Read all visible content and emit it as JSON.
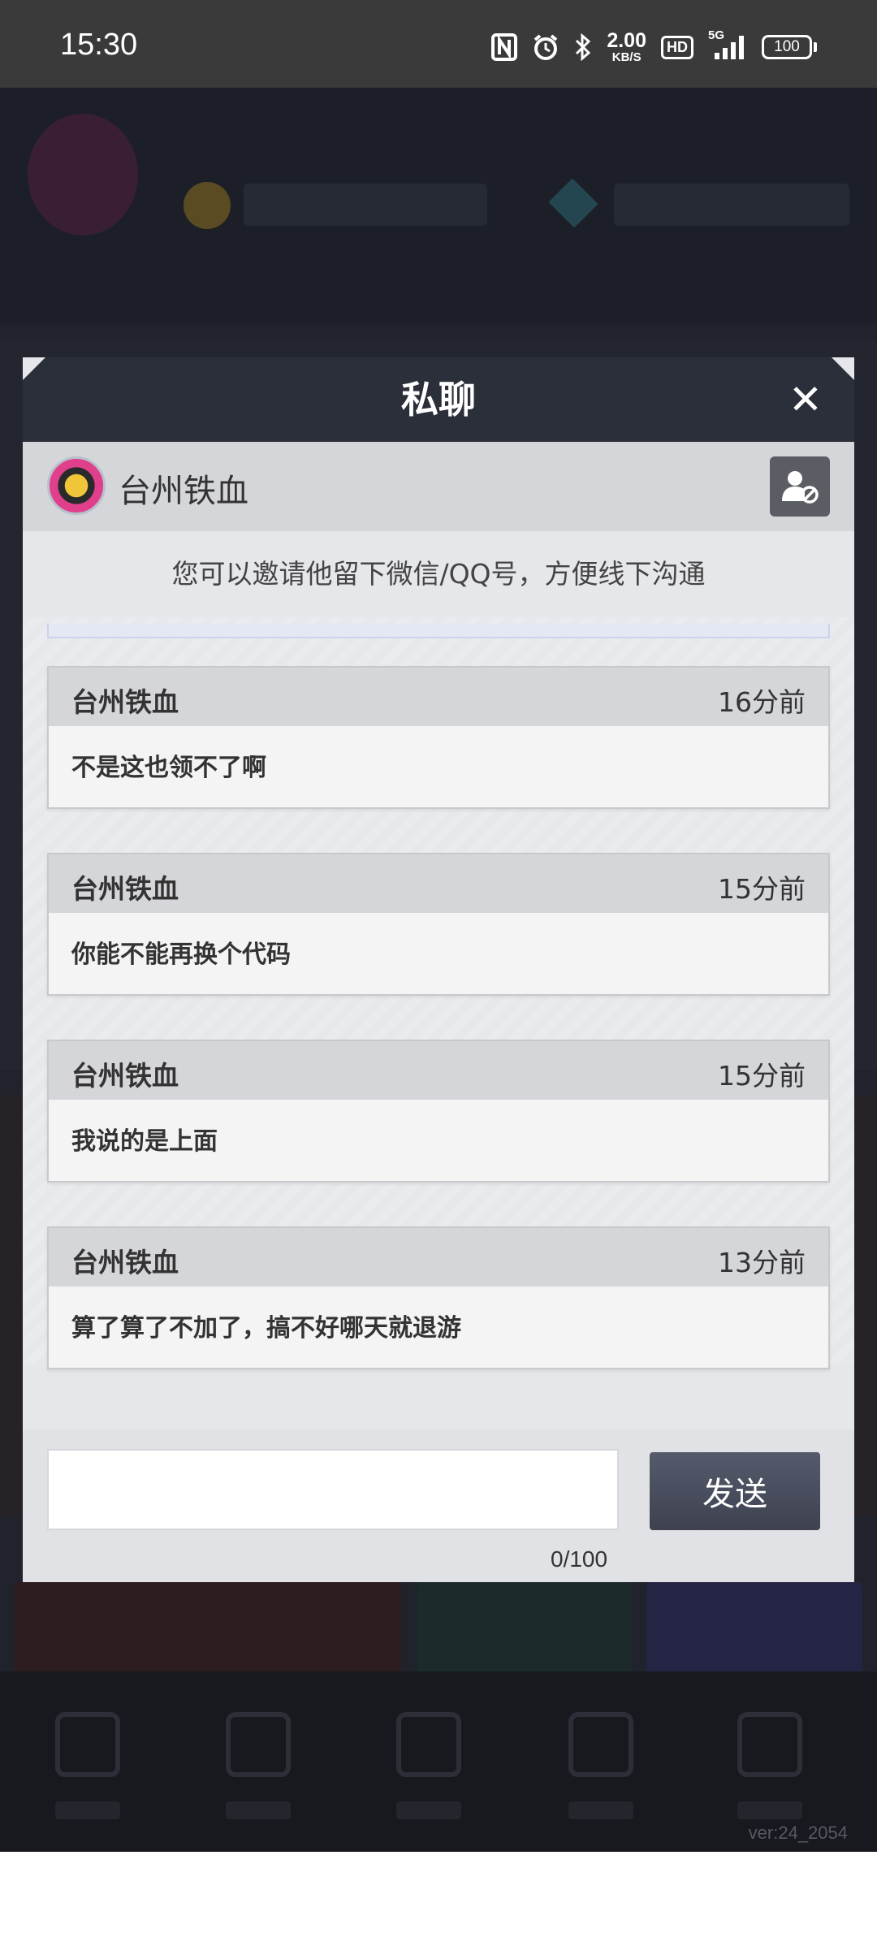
{
  "status_bar": {
    "time": "15:30",
    "net_speed_value": "2.00",
    "net_speed_unit": "KB/S",
    "hd_label": "HD",
    "network_label": "5G",
    "battery_level": "100",
    "icons": [
      "nfc-icon",
      "alarm-icon",
      "bluetooth-icon",
      "hd-icon",
      "signal-icon",
      "battery-icon"
    ]
  },
  "modal": {
    "title": "私聊",
    "close_glyph": "✕",
    "peer": {
      "name": "台州铁血"
    },
    "invite_hint": "您可以邀请他留下微信/QQ号，方便线下沟通",
    "messages": [
      {
        "sender": "台州铁血",
        "time": "16分前",
        "text": "不是这也领不了啊"
      },
      {
        "sender": "台州铁血",
        "time": "15分前",
        "text": "你能不能再换个代码"
      },
      {
        "sender": "台州铁血",
        "time": "15分前",
        "text": "我说的是上面"
      },
      {
        "sender": "台州铁血",
        "time": "13分前",
        "text": "算了算了不加了，搞不好哪天就退游"
      }
    ],
    "input": {
      "value": "",
      "placeholder": ""
    },
    "send_label": "发送",
    "char_count": "0/100"
  },
  "footer": {
    "version": "ver:24_2054"
  },
  "colors": {
    "modal_header": "#2b2f39",
    "send_button": "#4a4e5e",
    "background_dim": "#20232b"
  }
}
